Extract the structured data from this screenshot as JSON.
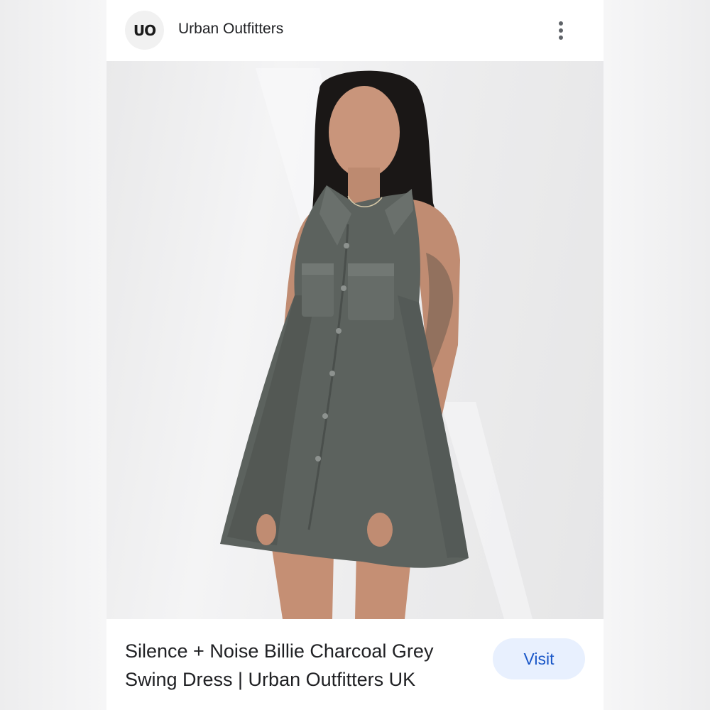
{
  "header": {
    "logo_text": "UO",
    "brand_name": "Urban Outfitters",
    "more_icon": "more-vert-icon"
  },
  "product_image": {
    "subject": "model wearing sleeveless charcoal grey button-down swing dress"
  },
  "footer": {
    "caption": "Silence + Noise Billie Charcoal Grey Swing Dress | Urban Outfitters UK",
    "visit_label": "Visit"
  },
  "colors": {
    "visit_bg": "#e8f0fe",
    "visit_text": "#1a57c8",
    "dress": "#5c625e"
  }
}
